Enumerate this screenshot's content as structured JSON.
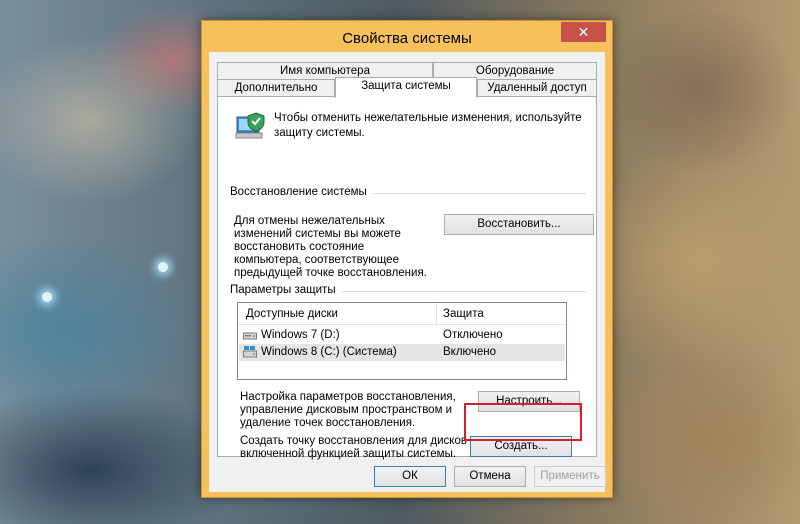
{
  "window": {
    "title": "Свойства системы",
    "close_glyph": "✕"
  },
  "tabs": [
    {
      "label": "Имя компьютера"
    },
    {
      "label": "Оборудование"
    },
    {
      "label": "Дополнительно"
    },
    {
      "label": "Защита системы",
      "active": true
    },
    {
      "label": "Удаленный доступ"
    }
  ],
  "panel": {
    "intro_text": "Чтобы отменить нежелательные изменения, используйте защиту системы.",
    "restore_group": {
      "label": "Восстановление системы",
      "description": "Для отмены нежелательных изменений системы вы можете восстановить состояние компьютера, соответствующее предыдущей точке восстановления.",
      "button": "Восстановить..."
    },
    "protection_group": {
      "label": "Параметры защиты",
      "columns": [
        "Доступные диски",
        "Защита"
      ],
      "rows": [
        {
          "drive": "Windows 7 (D:)",
          "protection": "Отключено",
          "icon": "drive-icon",
          "selected": false
        },
        {
          "drive": "Windows 8 (C:) (Система)",
          "protection": "Включено",
          "icon": "system-drive-icon",
          "selected": true
        }
      ],
      "configure_text": "Настройка параметров восстановления, управление дисковым пространством и удаление точек восстановления.",
      "configure_button": "Настроить...",
      "create_text": "Создать точку восстановления для дисков с включенной функцией защиты системы.",
      "create_button": "Создать..."
    }
  },
  "footer": {
    "ok": "ОК",
    "cancel": "Отмена",
    "apply": "Применить"
  },
  "colors": {
    "title_bar": "#f6c15a",
    "close_button": "#c7504a",
    "highlight": "#d4202a"
  }
}
